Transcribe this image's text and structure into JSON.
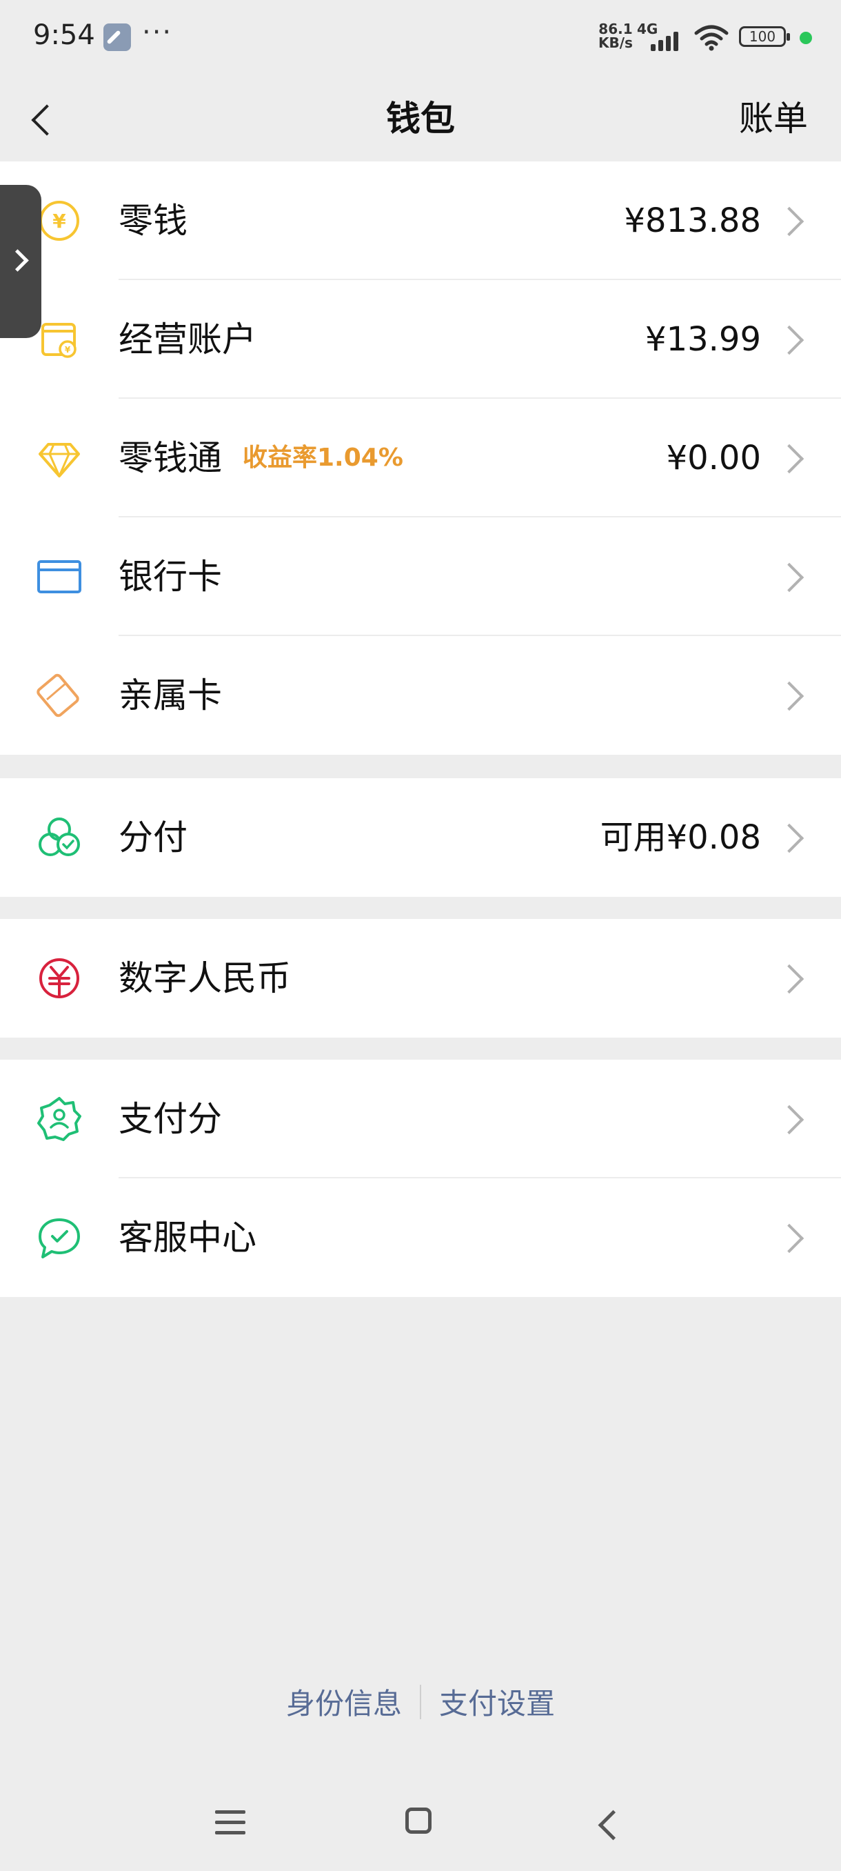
{
  "status": {
    "time": "9:54",
    "net_speed_top": "86.1",
    "net_speed_bottom": "KB/s",
    "net_type": "4G",
    "battery": "100"
  },
  "nav": {
    "title": "钱包",
    "right_link": "账单"
  },
  "groups": [
    {
      "rows": [
        {
          "id": "change",
          "icon": "yuan-coin-icon",
          "label": "零钱",
          "value": "¥813.88"
        },
        {
          "id": "business-account",
          "icon": "shop-wallet-icon",
          "label": "经营账户",
          "value": "¥13.99"
        },
        {
          "id": "change-fund",
          "icon": "diamond-icon",
          "label": "零钱通",
          "sub": "收益率1.04%",
          "value": "¥0.00"
        },
        {
          "id": "bank-card",
          "icon": "bank-card-icon",
          "label": "银行卡",
          "value": ""
        },
        {
          "id": "family-card",
          "icon": "family-card-icon",
          "label": "亲属卡",
          "value": ""
        }
      ]
    },
    {
      "rows": [
        {
          "id": "fenfu",
          "icon": "fenfu-icon",
          "label": "分付",
          "value": "可用¥0.08"
        }
      ]
    },
    {
      "rows": [
        {
          "id": "digital-rmb",
          "icon": "digital-rmb-icon",
          "label": "数字人民币",
          "value": ""
        }
      ]
    },
    {
      "rows": [
        {
          "id": "pay-score",
          "icon": "pay-score-icon",
          "label": "支付分",
          "value": ""
        },
        {
          "id": "customer-service",
          "icon": "customer-service-icon",
          "label": "客服中心",
          "value": ""
        }
      ]
    }
  ],
  "footer": {
    "identity": "身份信息",
    "pay_settings": "支付设置"
  },
  "colors": {
    "background": "#ededed",
    "accent_orange": "#e99a2f",
    "link_blue": "#576b95",
    "wechat_green": "#07c160"
  }
}
